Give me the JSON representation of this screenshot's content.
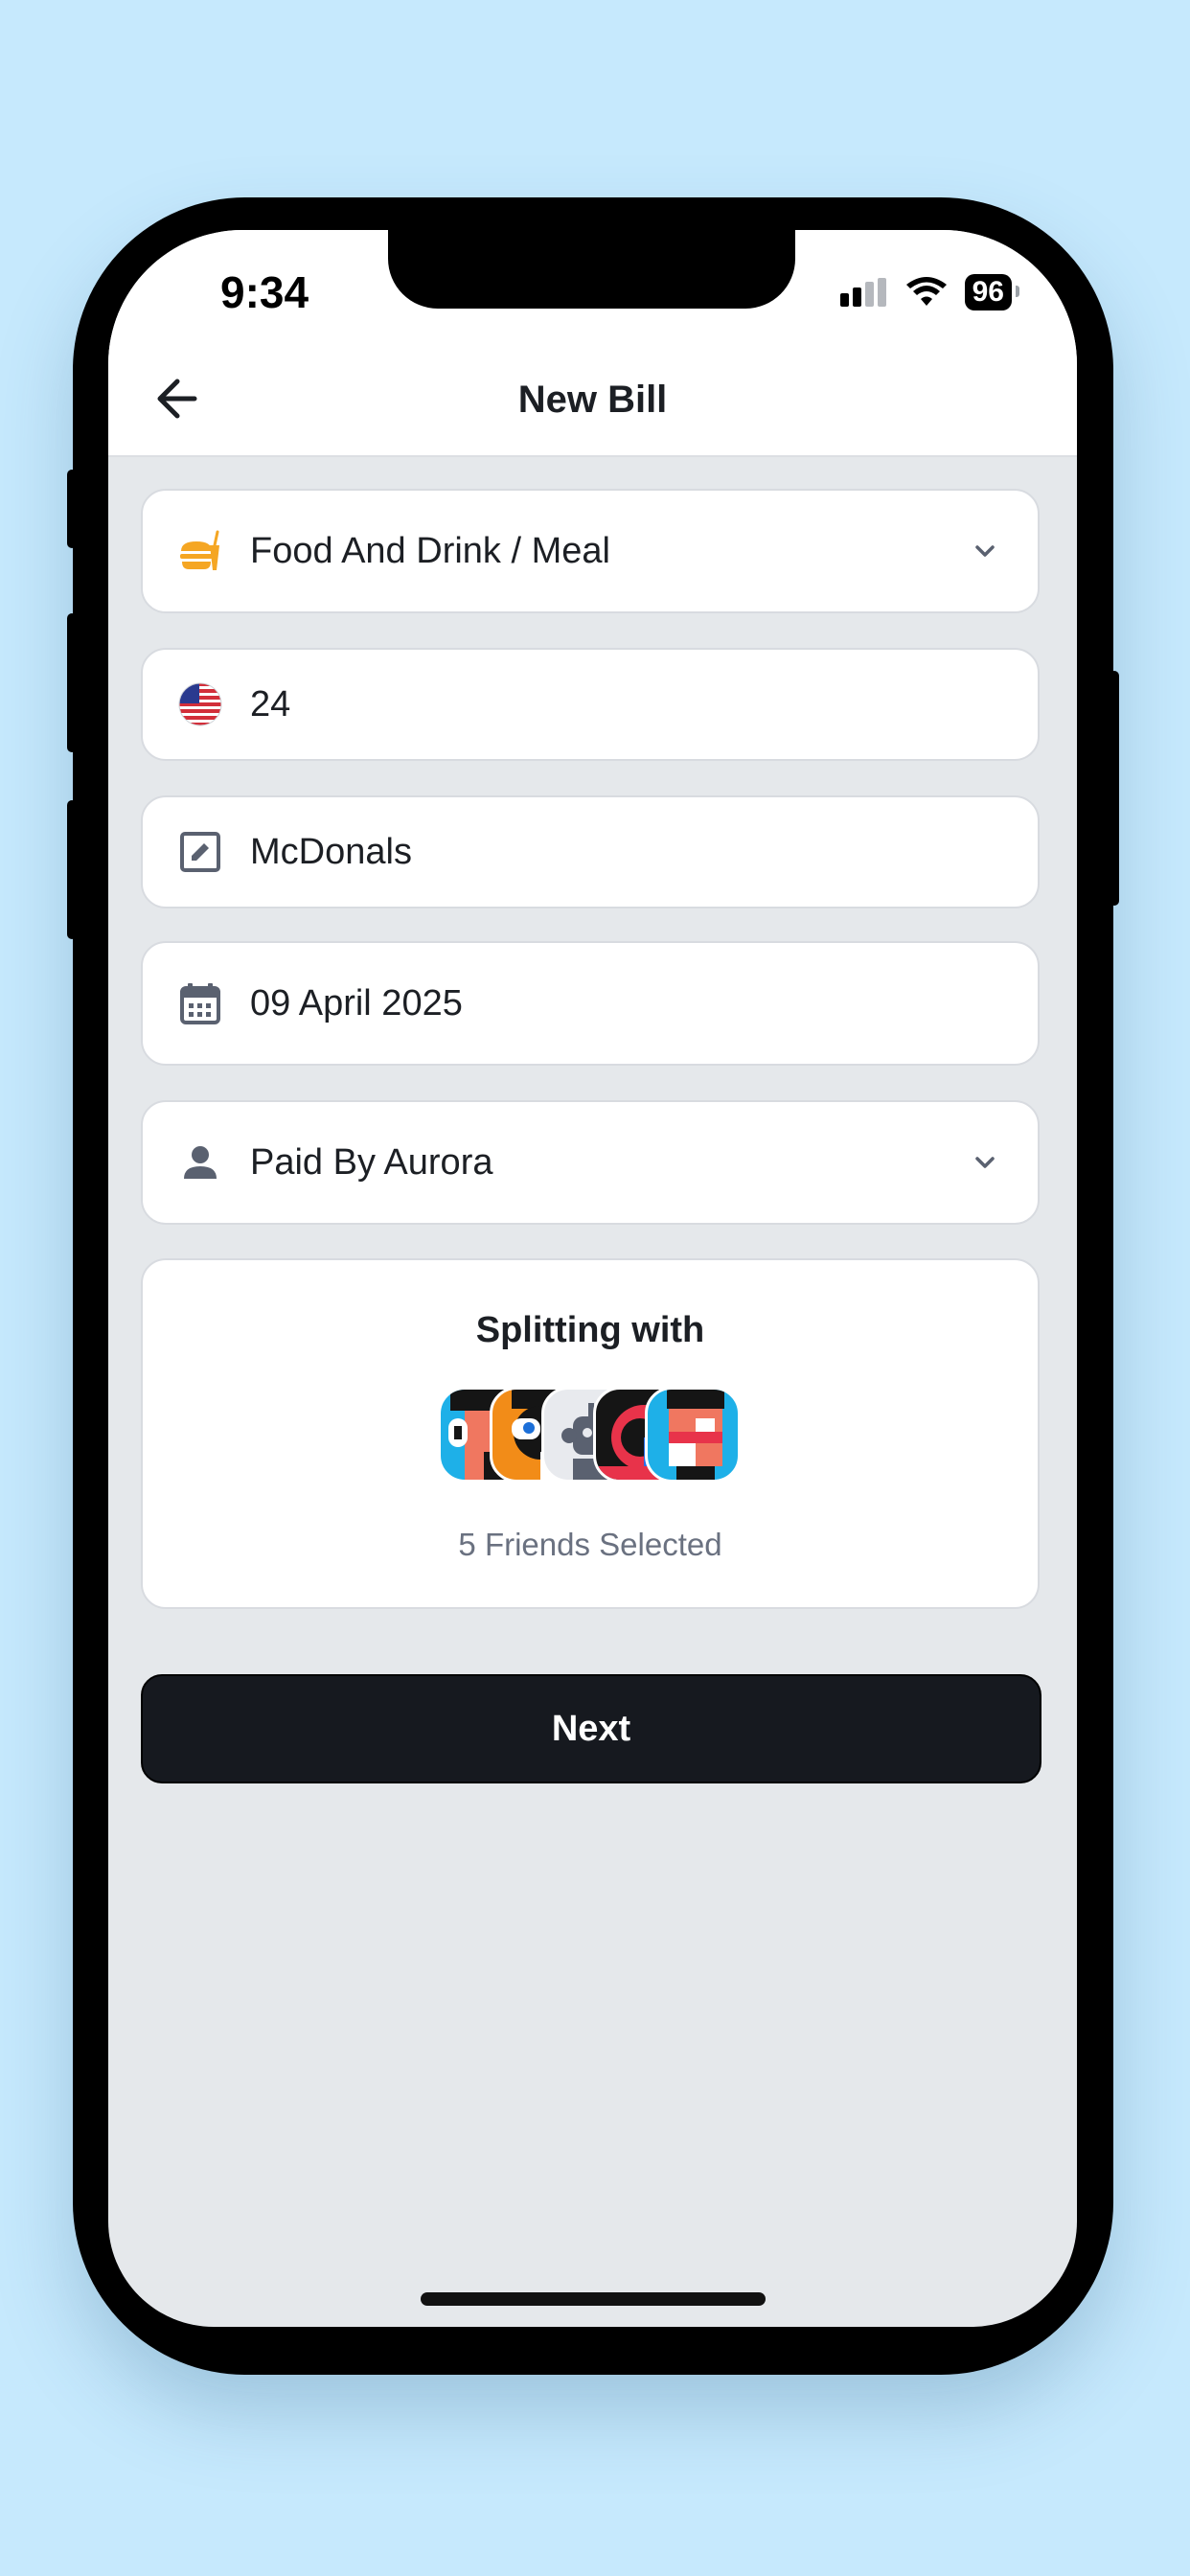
{
  "status_bar": {
    "time": "9:34",
    "battery": "96",
    "icons": [
      "cellular-signal-icon",
      "wifi-icon",
      "battery-icon"
    ]
  },
  "header": {
    "title": "New Bill",
    "back_icon": "arrow-left-icon"
  },
  "form": {
    "category": {
      "icon": "food-drink-icon",
      "value": "Food And Drink / Meal"
    },
    "amount": {
      "icon": "us-flag-icon",
      "value": "24"
    },
    "description": {
      "icon": "edit-icon",
      "value": "McDonals"
    },
    "date": {
      "icon": "calendar-icon",
      "value": "09 April 2025"
    },
    "paid_by": {
      "icon": "person-icon",
      "value": "Paid By Aurora"
    }
  },
  "splitting": {
    "title": "Splitting with",
    "subtitle": "5 Friends Selected",
    "friends_count": 5
  },
  "actions": {
    "next_label": "Next"
  },
  "colors": {
    "background": "#c6e9fd",
    "screen": "#e5e8eb",
    "accent_orange": "#f5a623",
    "button_dark": "#16191f",
    "icon_gray": "#5a6170"
  }
}
